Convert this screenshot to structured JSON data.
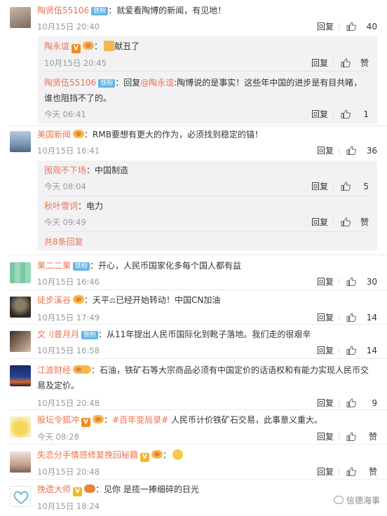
{
  "labels": {
    "reply": "回复",
    "like_zero": "赞",
    "more_replies": "共8条回复",
    "fans_badge": "铁粉"
  },
  "colors": {
    "username": "#eb7350",
    "badge_fans": "#62b5e6",
    "sub_bg": "#f2f2f5"
  },
  "comments": [
    {
      "user": "陶贤伍55106",
      "text": "就爱看陶博的新闻，有见地！",
      "time": "10月15日 20:40",
      "likes": "40"
    },
    {
      "user": "美国新闻",
      "text": "RMB要想有更大的作为，必须找到稳定的锚！",
      "time": "10月15日 16:41",
      "likes": "36"
    },
    {
      "user": "果二二果",
      "text": "开心，人民币国家化多每个国人都有益",
      "time": "10月15日 16:46",
      "likes": "30"
    },
    {
      "user": "徒步溪谷",
      "text": "天平",
      "text2": "已经开始转动！中国CN加油",
      "time": "10月15日 17:49",
      "likes": "14"
    },
    {
      "user": "文刂普月月",
      "text": "从11年提出人民币国际化到靴子落地。我们走的很艰辛",
      "time": "10月15日 16:58",
      "likes": "14"
    },
    {
      "user": "江波财经",
      "text": "石油，铁矿石等大宗商品必须有中国定价的话语权和有能力实现人民币交易及定价。",
      "time": "10月15日 20:48",
      "likes": "9"
    },
    {
      "user": "股坛令狐冲",
      "mention": "#百年变局录#",
      "text": " 人民币计价铁矿石交易，此事意义重大。",
      "time": "今天 08:28",
      "likes": ""
    },
    {
      "user": "失恋分手情感修复挽回秘籍",
      "text": "",
      "time": "10月15日 20:48",
      "likes": ""
    },
    {
      "user": "挽遗大师",
      "text": "见你 是揽一捧细碎的日光",
      "time": "10月15日 18:24",
      "likes": ""
    }
  ],
  "replies": [
    {
      "user": "陶永谊",
      "text": "献丑了",
      "time": "10月15日 20:45",
      "likes": ""
    },
    {
      "user": "陶贤伍55106",
      "prefix": "回复",
      "mention": "@陶永谊",
      "text": ":陶博说的是事实！这些年中国的进步是有目共睹，谁也阻挡不了的。",
      "time": "今天 06:41",
      "likes": "1"
    },
    {
      "user": "围观不下场",
      "text": "中国制造",
      "time": "今天 08:04",
      "likes": "5"
    },
    {
      "user": "秋叶雪词",
      "text": "电力",
      "time": "今天 09:49",
      "likes": ""
    }
  ],
  "watermark": "信德海事"
}
